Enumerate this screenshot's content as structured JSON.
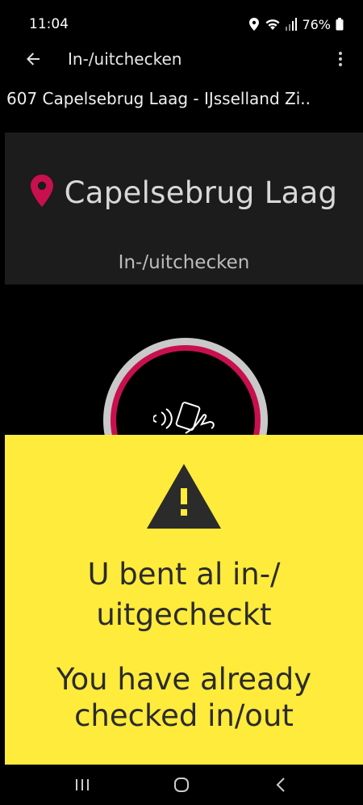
{
  "status_bar": {
    "time": "11:04",
    "battery": "76%"
  },
  "app_bar": {
    "title": "In-/uitchecken"
  },
  "route": {
    "text": "607 Capelsebrug Laag - IJsselland Zi.."
  },
  "station": {
    "name": "Capelsebrug Laag",
    "mode": "In-/uitchecken"
  },
  "warning": {
    "line_nl_1": "U bent al in-/",
    "line_nl_2": "uitgecheckt",
    "line_en_1": "You have already",
    "line_en_2": "checked in/out"
  },
  "icons": {
    "location": "location-icon",
    "wifi": "wifi-icon",
    "signal": "signal-icon",
    "battery": "battery-icon",
    "back": "arrow-back-icon",
    "menu": "more-vert-icon",
    "pin": "map-pin-icon",
    "nfc": "nfc-tap-icon",
    "warning": "warning-triangle-icon"
  },
  "colors": {
    "accent": "#c8104f",
    "warning_bg": "#ffeb3b",
    "panel": "#1c1c1c"
  }
}
